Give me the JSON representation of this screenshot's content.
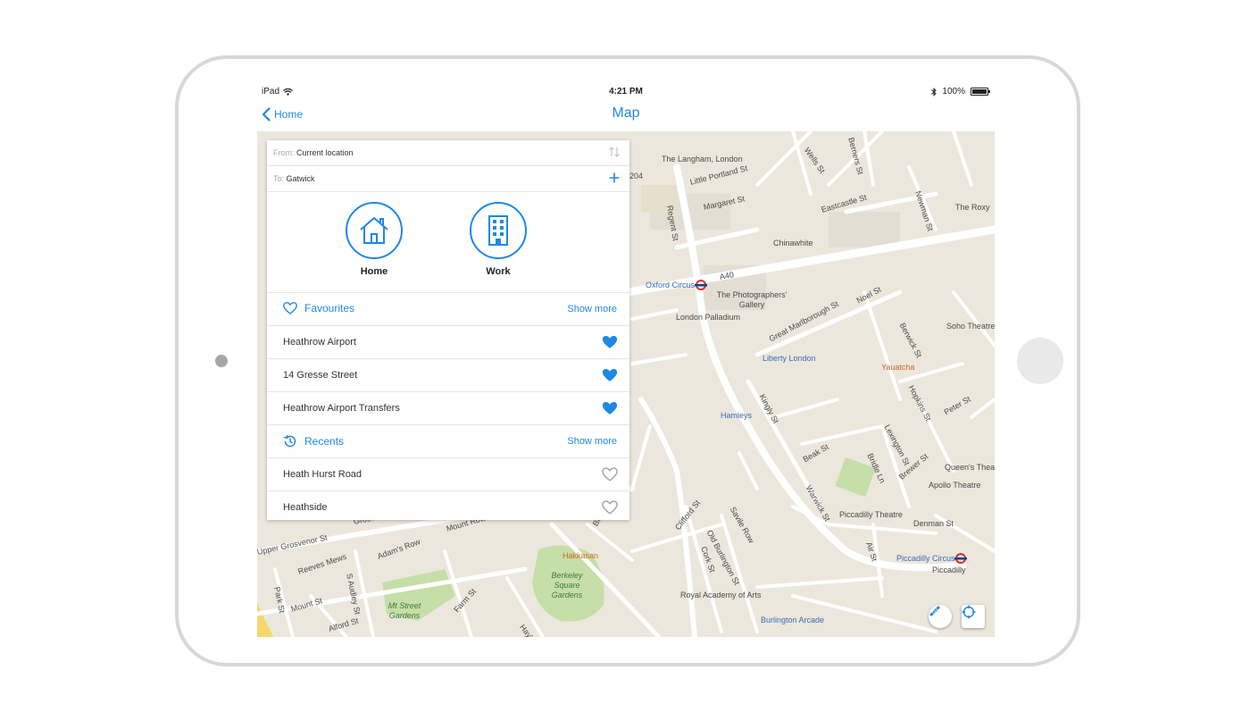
{
  "status_bar": {
    "device": "iPad",
    "time": "4:21 PM",
    "battery": "100%",
    "icons": [
      "wifi-icon",
      "bluetooth-icon",
      "battery-icon"
    ]
  },
  "nav_bar": {
    "back_label": "Home",
    "title": "Map"
  },
  "route": {
    "from_label": "From:",
    "from_value": "Current location",
    "to_label": "To:",
    "to_value": "Gatwick",
    "icons": [
      "swap-icon",
      "add-icon"
    ]
  },
  "quick_destinations": [
    {
      "label": "Home",
      "icon": "house-icon"
    },
    {
      "label": "Work",
      "icon": "building-icon"
    }
  ],
  "favourites": {
    "title": "Favourites",
    "show_more": "Show more",
    "items": [
      {
        "label": "Heathrow Airport",
        "favourited": true
      },
      {
        "label": "14 Gresse Street",
        "favourited": true
      },
      {
        "label": "Heathrow Airport Transfers",
        "favourited": true
      }
    ]
  },
  "recents": {
    "title": "Recents",
    "show_more": "Show more",
    "items": [
      {
        "label": "Heath Hurst Road",
        "favourited": false
      },
      {
        "label": "Heathside",
        "favourited": false
      }
    ]
  },
  "map": {
    "labels": [
      "The Langham, London",
      "Little Portland St",
      "Margaret St",
      "Regent St",
      "Wells St",
      "Berners St",
      "Newman St",
      "Eastcastle St",
      "The Roxy",
      "Chinawhite",
      "A40",
      "Oxford Circus",
      "The Photographers' Gallery",
      "London Palladium",
      "Noel St",
      "Great Marlborough St",
      "Berwick St",
      "Soho Theatre",
      "Liberty London",
      "Yauatcha",
      "Kingly St",
      "Hamleys",
      "Hopkins St",
      "Lexington St",
      "Peter St",
      "Beak St",
      "Bridle Ln",
      "Brewer St",
      "Queen's Theatre",
      "Apollo Theatre",
      "Warwick St",
      "Piccadilly Theatre",
      "Denman St",
      "Air St",
      "Piccadilly Circus",
      "Piccadilly",
      "Clifford St",
      "Savile Row",
      "Old Burlington St",
      "Cork St",
      "Royal Academy of Arts",
      "Burlington Arcade",
      "Upper Grosvenor St",
      "Grosvenor St",
      "Mount Row",
      "Bruton St",
      "Hakkasan",
      "Berkeley Square Gardens",
      "Adam's Row",
      "Reeves Mews",
      "Park St",
      "S Audley St",
      "Mt Street Gardens",
      "Farm St",
      "Mount St",
      "Alford St",
      "Hay's M",
      "204"
    ],
    "controls": [
      "ruler-icon",
      "locate-icon"
    ]
  },
  "colors": {
    "accent": "#1e88e5",
    "map_background": "#ece7dd",
    "road": "#ffffff",
    "park": "#c6dea8"
  }
}
